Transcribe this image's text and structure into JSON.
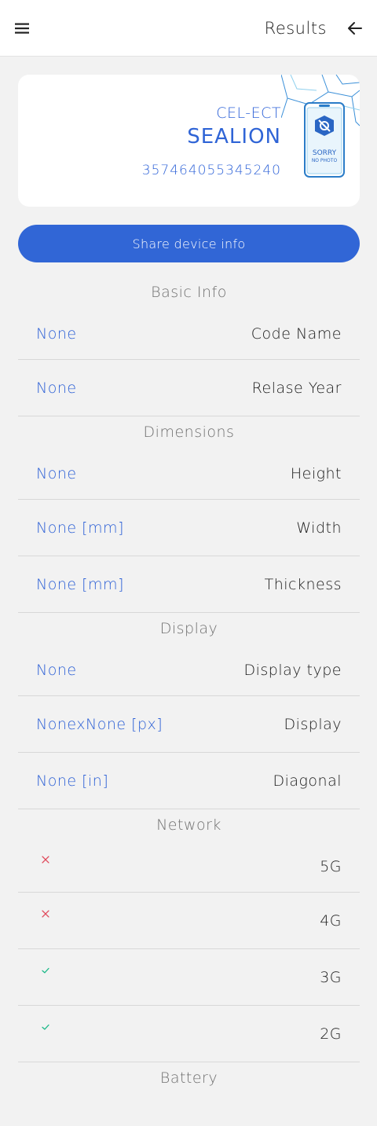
{
  "appbar": {
    "title": "Results"
  },
  "device": {
    "brand": "CEL-ECT",
    "model": "SEALION",
    "imei": "357464055345240",
    "image_text_1": "SORRY",
    "image_text_2": "NO PHOTO"
  },
  "share_label": "Share device info",
  "colors": {
    "accent": "#3166d6",
    "cross": "#e0485a",
    "check": "#1db989"
  },
  "sections": [
    {
      "title": "Basic Info",
      "rows": [
        {
          "value": "None",
          "label": "Code Name"
        },
        {
          "value": "None",
          "label": "Relase Year"
        }
      ]
    },
    {
      "title": "Dimensions",
      "rows": [
        {
          "value": "None",
          "label": "Height"
        },
        {
          "value": "None [mm]",
          "label": "Width"
        },
        {
          "value": "None [mm]",
          "label": "Thickness"
        }
      ]
    },
    {
      "title": "Display",
      "rows": [
        {
          "value": "None",
          "label": "Display type"
        },
        {
          "value": "NonexNone [px]",
          "label": "Display"
        },
        {
          "value": "None [in]",
          "label": "Diagonal"
        }
      ]
    },
    {
      "title": "Network",
      "rows": [
        {
          "status": "cross-icon",
          "label": "5G"
        },
        {
          "status": "cross-icon",
          "label": "4G"
        },
        {
          "status": "check-icon",
          "label": "3G"
        },
        {
          "status": "check-icon",
          "label": "2G"
        }
      ]
    },
    {
      "title": "Battery",
      "rows": []
    }
  ]
}
